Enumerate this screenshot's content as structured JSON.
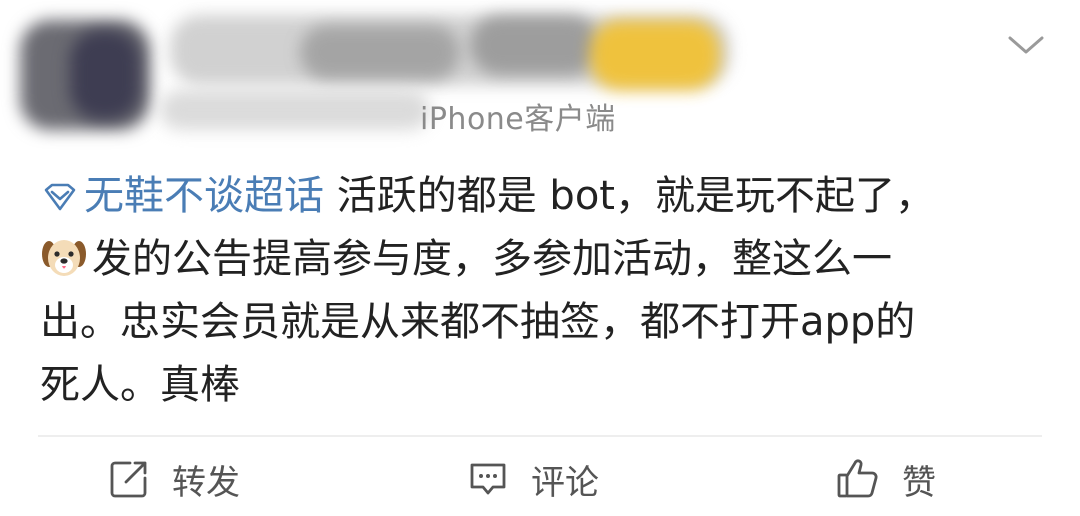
{
  "header": {
    "source_text": "iPhone客户端",
    "icons": {
      "collapse": "chevron-down-icon"
    }
  },
  "post": {
    "topic": "无鞋不谈超话",
    "line1_rest": " 活跃的都是 bot，就是玩不起了，",
    "line2_rest": "发的公告提高参与度，多参加活动，整这么一",
    "line3": "出。忠实会员就是从来都不抽签，都不打开app的",
    "line4": "死人。真棒",
    "icons": {
      "topic": "diamond-topic-icon",
      "emoji": "dog-face-emoji"
    }
  },
  "actions": {
    "repost_label": "转发",
    "comment_label": "评论",
    "like_label": "赞"
  },
  "colors": {
    "topic_link": "#4a7db5",
    "text": "#222222",
    "action_text": "#555555"
  }
}
